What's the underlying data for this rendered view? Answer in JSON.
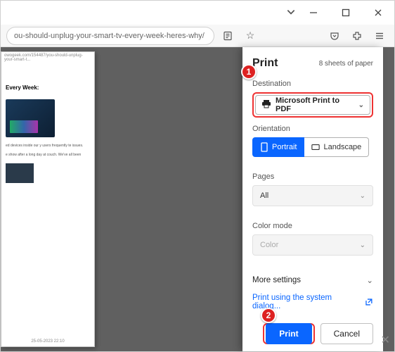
{
  "url_fragment": "ou-should-unplug-your-smart-tv-every-week-heres-why/",
  "preview": {
    "title_url": "owogeek.com/154487/you-should-unplug-your-smart-t...",
    "heading": "Every Week:",
    "para1": "ed devices inside our y users frequently te issues.",
    "para2": "e show after a long day at couch. We've all been",
    "footer": "25-05-2023  22:10"
  },
  "print": {
    "title": "Print",
    "sheets": "8 sheets of paper",
    "destination_label": "Destination",
    "destination_value": "Microsoft Print to PDF",
    "orientation_label": "Orientation",
    "portrait": "Portrait",
    "landscape": "Landscape",
    "pages_label": "Pages",
    "pages_value": "All",
    "color_label": "Color mode",
    "color_value": "Color",
    "more": "More settings",
    "system_link": "Print using the system dialog...",
    "print_btn": "Print",
    "cancel_btn": "Cancel"
  },
  "badges": {
    "b1": "1",
    "b2": "2"
  }
}
